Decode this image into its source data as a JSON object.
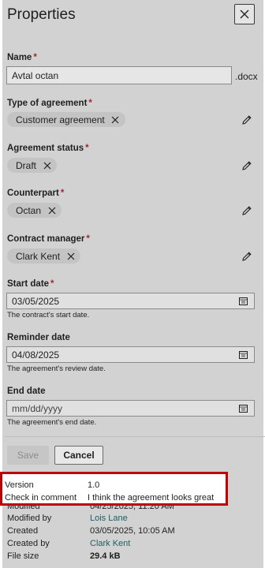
{
  "header": {
    "title": "Properties"
  },
  "name_field": {
    "label": "Name",
    "value": "Avtal octan",
    "extension": ".docx"
  },
  "type_field": {
    "label": "Type of agreement",
    "tag": "Customer agreement"
  },
  "status_field": {
    "label": "Agreement status",
    "tag": "Draft"
  },
  "counterpart_field": {
    "label": "Counterpart",
    "tag": "Octan"
  },
  "manager_field": {
    "label": "Contract manager",
    "tag": "Clark Kent"
  },
  "start_date": {
    "label": "Start date",
    "value": "03/05/2025",
    "help": "The contract's start date."
  },
  "reminder_date": {
    "label": "Reminder date",
    "value": "04/08/2025",
    "help": "The agreement's review date."
  },
  "end_date": {
    "label": "End date",
    "placeholder": "mm/dd/yyyy",
    "help": "The agreement's end date."
  },
  "actions": {
    "save": "Save",
    "cancel": "Cancel"
  },
  "required_mark": "*",
  "highlight": {
    "version_label": "Version",
    "version_value": "1.0",
    "comment_label": "Check in comment",
    "comment_value": "I think the agreement looks great"
  },
  "metadata": {
    "modified_label": "Modified",
    "modified_value": "04/25/2025, 11:20 AM",
    "modified_by_label": "Modified by",
    "modified_by_value": "Lois Lane",
    "created_label": "Created",
    "created_value": "03/05/2025, 10:05 AM",
    "created_by_label": "Created by",
    "created_by_value": "Clark Kent",
    "file_size_label": "File size",
    "file_size_value": "29.4 kB"
  },
  "colors": {
    "required": "#a4262c",
    "highlight_border": "#c00000",
    "link": "#1d5e64"
  }
}
